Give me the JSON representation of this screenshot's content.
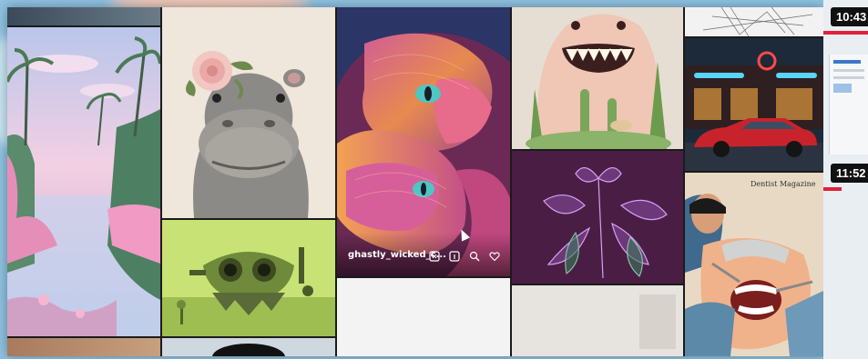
{
  "gallery": {
    "hover_caption": "ghastly_wicked_c...",
    "magazine_title": "Dentist Magazine",
    "action_icons": [
      "pin-icon",
      "info-icon",
      "search-icon",
      "heart-icon"
    ]
  },
  "side_videos": [
    {
      "timestamp": "10:43"
    },
    {
      "timestamp": "11:52"
    }
  ],
  "colors": {
    "page_background": "#8fc3e2",
    "progress_red": "#e0213a"
  }
}
